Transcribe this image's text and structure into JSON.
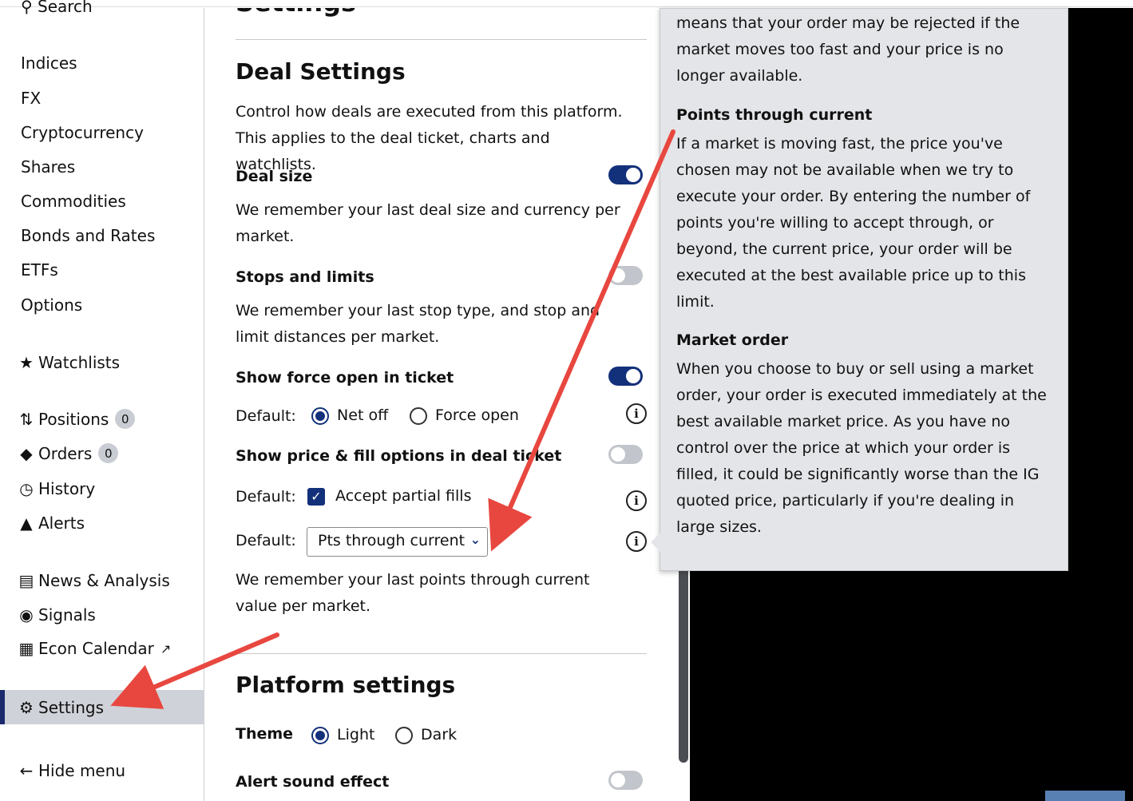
{
  "sidebar": {
    "search": "Search",
    "markets": [
      "Indices",
      "FX",
      "Cryptocurrency",
      "Shares",
      "Commodities",
      "Bonds and Rates",
      "ETFs",
      "Options"
    ],
    "watchlists": "Watchlists",
    "positions": {
      "label": "Positions",
      "count": "0"
    },
    "orders": {
      "label": "Orders",
      "count": "0"
    },
    "history": "History",
    "alerts": "Alerts",
    "news": "News & Analysis",
    "signals": "Signals",
    "econ": "Econ Calendar",
    "settings": "Settings",
    "hide": "Hide menu"
  },
  "main": {
    "page_title": "Settings",
    "deal": {
      "heading": "Deal Settings",
      "intro": "Control how deals are executed from this platform. This applies to the deal ticket, charts and watchlists.",
      "deal_size": {
        "label": "Deal size",
        "desc": "We remember your last deal size and currency per market."
      },
      "stops": {
        "label": "Stops and limits",
        "desc": "We remember your last stop type, and stop and limit distances per market."
      },
      "force": {
        "label": "Show force open in ticket",
        "default_label": "Default:",
        "opt1": "Net off",
        "opt2": "Force open"
      },
      "price_fill": {
        "label": "Show price & fill options in deal ticket",
        "default_label": "Default:",
        "partial": "Accept partial fills"
      },
      "order_type": {
        "default_label": "Default:",
        "selected": "Pts through current",
        "desc": "We remember your last points through current value per market."
      }
    },
    "platform": {
      "heading": "Platform settings",
      "theme": {
        "label": "Theme",
        "opt1": "Light",
        "opt2": "Dark"
      },
      "alert_sound": {
        "label": "Alert sound effect"
      }
    }
  },
  "tooltip": {
    "p0": "means that your order may be rejected if the market moves too fast and your price is no longer available.",
    "t1": "Points through current",
    "p1": "If a market is moving fast, the price you've chosen may not be available when we try to execute your order. By entering the number of points you're willing to accept through, or beyond, the current price, your order will be executed at the best available price up to this limit.",
    "t2": "Market order",
    "p2": "When you choose to buy or sell using a market order, your order is executed immediately at the best available market price. As you have no control over the price at which your order is filled, it could be significantly worse than the IG quoted price, particularly if you're dealing in large sizes."
  },
  "colors": {
    "accent": "#13307a",
    "annotation": "#e8473f"
  }
}
